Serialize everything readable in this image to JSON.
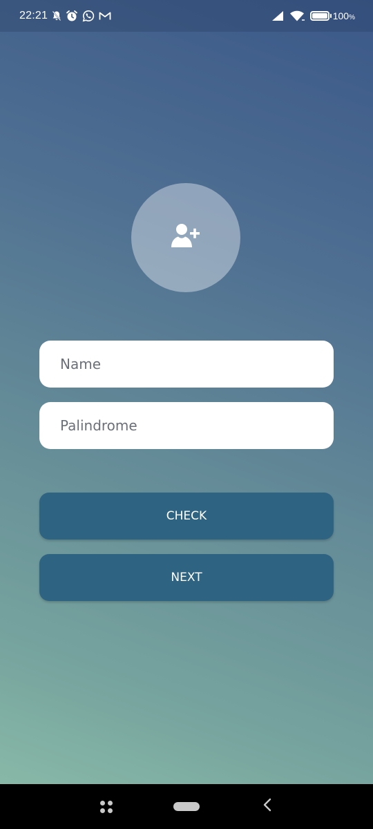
{
  "status_bar": {
    "time": "22:21",
    "left_icons": [
      "bell-off-icon",
      "alarm-icon",
      "whatsapp-icon",
      "gmail-icon"
    ],
    "right_icons": [
      "signal-icon",
      "wifi-icon",
      "battery-icon"
    ],
    "battery_percent": "100",
    "battery_unit": "%"
  },
  "avatar": {
    "icon": "add-user-icon"
  },
  "form": {
    "name_placeholder": "Name",
    "name_value": "",
    "palindrome_placeholder": "Palindrome",
    "palindrome_value": ""
  },
  "buttons": {
    "check_label": "CHECK",
    "next_label": "NEXT"
  },
  "nav_bar": {
    "icons": [
      "recent-apps-icon",
      "home-icon",
      "back-icon"
    ]
  },
  "colors": {
    "gradient_top": "#3b5888",
    "gradient_bottom": "#8dbfaa",
    "button_bg": "#2f6382",
    "input_bg": "#ffffff",
    "nav_bg": "#000000"
  }
}
